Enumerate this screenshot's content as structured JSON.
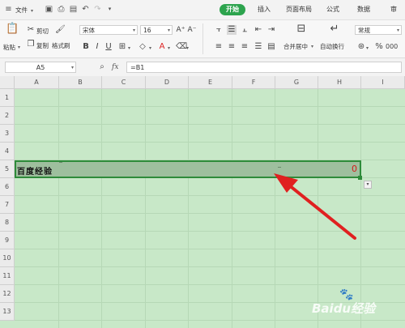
{
  "titlebar": {
    "menu_label": "文件",
    "tabs": [
      "开始",
      "插入",
      "页面布局",
      "公式",
      "数据",
      "审"
    ]
  },
  "ribbon": {
    "paste_label": "粘贴",
    "cut_label": "剪切",
    "copy_label": "复制",
    "format_painter_label": "格式刷",
    "font_name": "宋体",
    "font_size": "16",
    "bold": "B",
    "italic": "I",
    "underline": "U",
    "font_color_glyph": "A",
    "merge_center_label": "合并居中",
    "wrap_label": "自动换行",
    "number_format": "常规"
  },
  "formula_bar": {
    "name_box": "A5",
    "fx": "fx",
    "formula": "=B1"
  },
  "grid": {
    "columns": [
      "A",
      "B",
      "C",
      "D",
      "E",
      "F",
      "G",
      "H",
      "I"
    ],
    "rows": [
      "1",
      "2",
      "3",
      "4",
      "5",
      "6",
      "7",
      "8",
      "9",
      "10",
      "11",
      "12",
      "13"
    ],
    "cell_a5": "百度经验",
    "cell_h5": "0"
  },
  "watermark": "Baidu经验",
  "colors": {
    "accent": "#2da44e",
    "sheet_bg": "#c8e8c8",
    "selection_bg": "#9ebf9e",
    "selection_border": "#2e8b3a",
    "arrow": "#e02020"
  }
}
